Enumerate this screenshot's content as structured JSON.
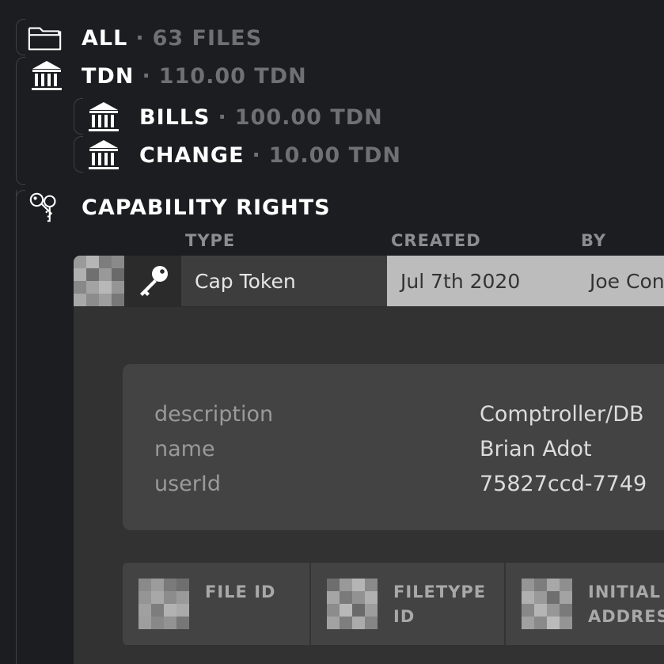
{
  "tree": {
    "all": {
      "label": "ALL",
      "meta": "63 FILES",
      "icon": "folder-icon"
    },
    "tdn": {
      "label": "TDN",
      "meta": "110.00 TDN",
      "icon": "bank-icon"
    },
    "bills": {
      "label": "BILLS",
      "meta": "100.00 TDN",
      "icon": "bank-icon"
    },
    "change": {
      "label": "CHANGE",
      "meta": "10.00 TDN",
      "icon": "bank-icon"
    },
    "capability": {
      "label": "CAPABILITY RIGHTS",
      "icon": "keys-icon"
    },
    "separator": "·"
  },
  "columns": {
    "type": "TYPE",
    "created": "CREATED",
    "by": "BY"
  },
  "record": {
    "type": "Cap Token",
    "created": "Jul 7th 2020",
    "by": "Joe Con",
    "icon": "key-icon",
    "properties": [
      {
        "key": "description",
        "value": "Comptroller/DB"
      },
      {
        "key": "name",
        "value": "Brian Adot"
      },
      {
        "key": "userId",
        "value": "75827ccd-7749"
      }
    ],
    "file_columns": [
      {
        "line1": "FILE ID",
        "line2": ""
      },
      {
        "line1": "FILETYPE",
        "line2": "ID"
      },
      {
        "line1": "INITIAL",
        "line2": "ADDRES"
      }
    ]
  },
  "colors": {
    "background": "#1c1d20",
    "muted_text": "#6e7074",
    "card": "#323232",
    "created_bg": "#bcbcbc"
  }
}
